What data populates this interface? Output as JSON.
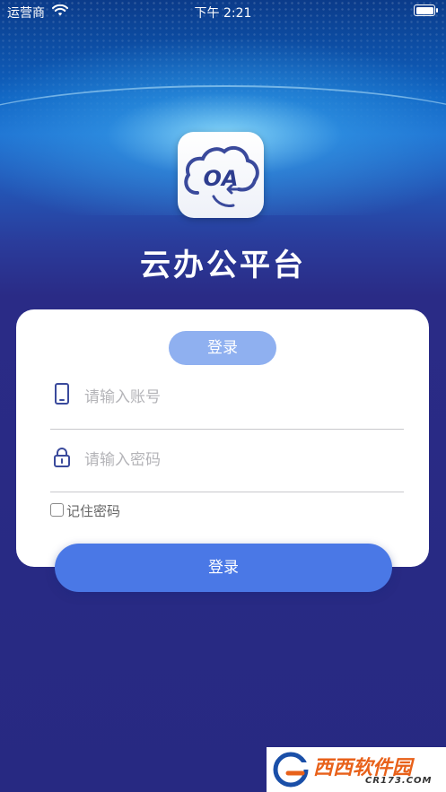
{
  "status_bar": {
    "carrier": "运营商",
    "time": "下午 2:21"
  },
  "logo": {
    "text": "OA"
  },
  "app_title": "云办公平台",
  "login_form": {
    "tab_label": "登录",
    "account_placeholder": "请输入账号",
    "password_placeholder": "请输入密码",
    "remember_label": "记住密码",
    "remember_checked": false,
    "submit_label": "登录"
  },
  "watermark": {
    "brand": "西西软件园",
    "url": "CR173.COM"
  },
  "colors": {
    "primary_button": "#4a78e6",
    "tab_pill": "#8fb0f0",
    "background": "#272982",
    "icon": "#3a4a9c"
  },
  "icons": [
    "wifi-icon",
    "battery-icon",
    "phone-icon",
    "lock-icon",
    "cloud-logo"
  ]
}
